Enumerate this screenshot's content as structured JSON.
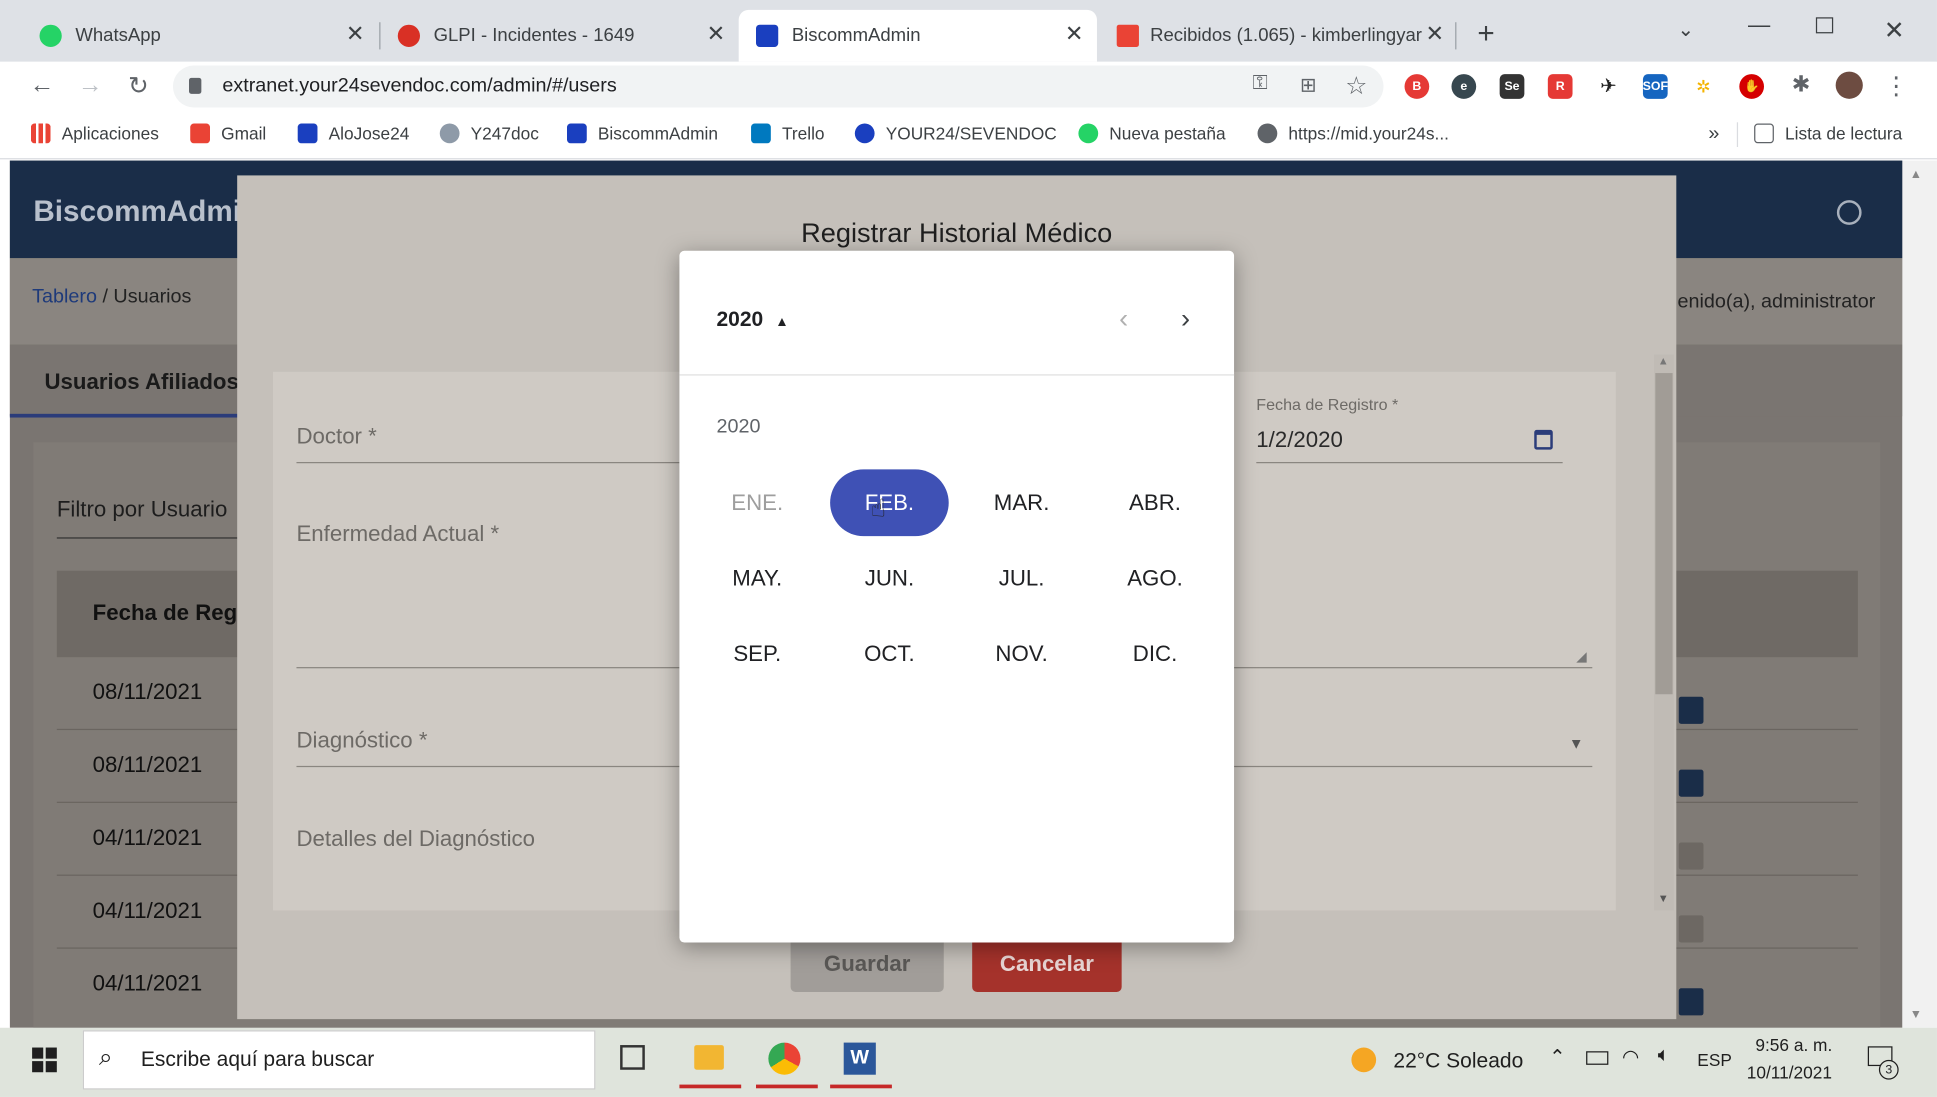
{
  "tabs": [
    {
      "label": "WhatsApp",
      "color": "#25d366"
    },
    {
      "label": "GLPI - Incidentes - 1649",
      "color": "#d93025"
    },
    {
      "label": "BiscommAdmin",
      "color": "#1a3fbf"
    },
    {
      "label": "Recibidos (1.065) - kimberlingyar",
      "color": "#ea4335"
    }
  ],
  "address": {
    "url": "extranet.your24sevendoc.com/admin/#/users"
  },
  "bookmarks": [
    {
      "label": "Aplicaciones",
      "color": "#ea4335"
    },
    {
      "label": "Gmail",
      "color": "#ea4335"
    },
    {
      "label": "AloJose24",
      "color": "#1a3fbf"
    },
    {
      "label": "Y247doc",
      "color": "#5f6368"
    },
    {
      "label": "BiscommAdmin",
      "color": "#1a3fbf"
    },
    {
      "label": "Trello",
      "color": "#0079bf"
    },
    {
      "label": "YOUR24/SEVENDOC",
      "color": "#1a3fbf"
    },
    {
      "label": "Nueva pestaña",
      "color": "#25d366"
    },
    {
      "label": "https://mid.your24s...",
      "color": "#5f6368"
    }
  ],
  "reading_list": "Lista de lectura",
  "more_bookmarks": "»",
  "app": {
    "title": "BiscommAdmin",
    "breadcrumb_link": "Tablero",
    "breadcrumb_sep": " / ",
    "breadcrumb_current": "Usuarios",
    "welcome": "enido(a), administrator",
    "tab_label": "Usuarios Afiliados",
    "filter_placeholder": "Filtro por Usuario",
    "table_header": "Fecha de Reg",
    "rows": [
      "08/11/2021",
      "08/11/2021",
      "04/11/2021",
      "04/11/2021",
      "04/11/2021"
    ]
  },
  "modal": {
    "title": "Registrar Historial Médico",
    "doctor_label": "Doctor *",
    "fecha_label": "Fecha de Registro *",
    "fecha_value": "1/2/2020",
    "enfermedad_label": "Enfermedad Actual *",
    "diagnostico_label": "Diagnóstico *",
    "detalles_label": "Detalles del Diagnóstico",
    "save_label": "Guardar",
    "cancel_label": "Cancelar"
  },
  "picker": {
    "header_year": "2020",
    "body_year": "2020",
    "months": [
      "ENE.",
      "FEB.",
      "MAR.",
      "ABR.",
      "MAY.",
      "JUN.",
      "JUL.",
      "AGO.",
      "SEP.",
      "OCT.",
      "NOV.",
      "DIC."
    ],
    "selected": "FEB.",
    "accent": "#3f51b5"
  },
  "taskbar": {
    "search_placeholder": "Escribe aquí para buscar",
    "weather": "22°C  Soleado",
    "lang": "ESP",
    "time": "9:56 a. m.",
    "date": "10/11/2021",
    "notifications": "3"
  }
}
